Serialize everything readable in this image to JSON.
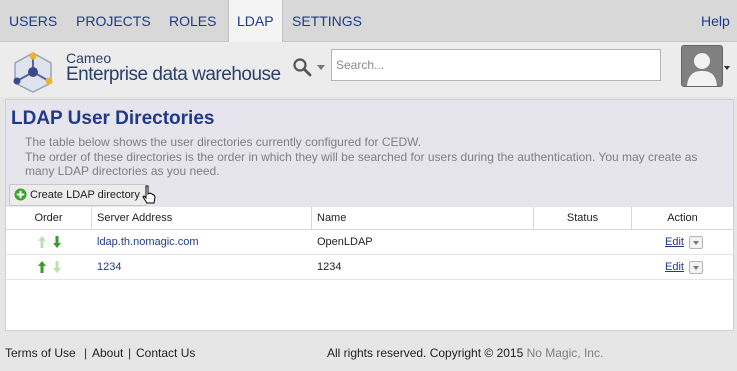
{
  "nav": {
    "tabs": [
      {
        "label": "USERS",
        "active": false
      },
      {
        "label": "PROJECTS",
        "active": false
      },
      {
        "label": "ROLES",
        "active": false
      },
      {
        "label": "LDAP",
        "active": true
      },
      {
        "label": "SETTINGS",
        "active": false
      }
    ],
    "help_label": "Help"
  },
  "header": {
    "logo_small": "Cameo",
    "logo_main": "Enterprise data warehouse",
    "search_placeholder": "Search..."
  },
  "page": {
    "title": "LDAP User Directories",
    "description_lines": [
      "The table below shows the user directories currently configured for CEDW.",
      "The order of these directories is the order in which they will be searched for users during the authentication. You may create as",
      "many LDAP directories as you need."
    ],
    "create_button_label": "Create LDAP directory"
  },
  "table": {
    "headers": [
      "Order",
      "Server Address",
      "Name",
      "Status",
      "Action"
    ],
    "rows": [
      {
        "server": "ldap.th.nomagic.com",
        "name": "OpenLDAP",
        "status": "",
        "action": "Edit",
        "up_enabled": false,
        "down_enabled": true
      },
      {
        "server": "1234",
        "name": "1234",
        "status": "",
        "action": "Edit",
        "up_enabled": true,
        "down_enabled": false
      }
    ]
  },
  "footer": {
    "links": [
      "Terms of Use",
      "About",
      "Contact Us"
    ],
    "copyright_prefix": "All rights reserved. Copyright © 2015",
    "company": "No Magic, Inc."
  },
  "colors": {
    "link": "#1f3a8a",
    "arrow_enabled": "#3a9a2a",
    "arrow_disabled": "#b9e0b0"
  }
}
